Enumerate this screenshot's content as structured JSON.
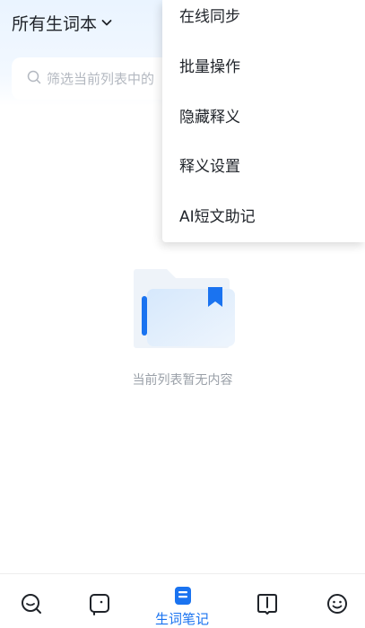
{
  "header": {
    "notebook_selector": "所有生词本",
    "search_placeholder": "筛选当前列表中的"
  },
  "menu": {
    "items": [
      "在线同步",
      "批量操作",
      "隐藏释义",
      "释义设置",
      "AI短文助记"
    ]
  },
  "empty_state": {
    "message": "当前列表暂无内容"
  },
  "bottom_nav": {
    "active_label": "生词笔记",
    "items": [
      {
        "icon": "search-icon",
        "active": false
      },
      {
        "icon": "face-box-icon",
        "active": false
      },
      {
        "icon": "notebook-icon",
        "active": true
      },
      {
        "icon": "book-icon",
        "active": false
      },
      {
        "icon": "smile-icon",
        "active": false
      }
    ]
  },
  "colors": {
    "accent": "#1a73f0",
    "text_primary": "#1f2329",
    "text_secondary": "#9aa0a8",
    "header_bg": "#eaf4ff"
  }
}
